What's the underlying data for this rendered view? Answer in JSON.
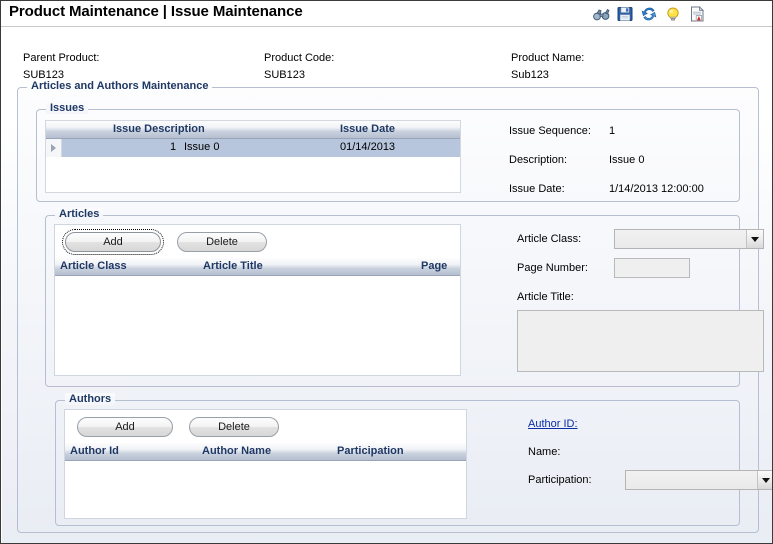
{
  "window": {
    "title_left": "Product Maintenance",
    "title_separator": "|",
    "title_right": "Issue Maintenance"
  },
  "toolbar": {
    "items": [
      {
        "name": "binoculars-icon",
        "label": "Find"
      },
      {
        "name": "save-icon",
        "label": "Save"
      },
      {
        "name": "refresh-icon",
        "label": "Refresh"
      },
      {
        "name": "lightbulb-icon",
        "label": "Hint"
      },
      {
        "name": "report-icon",
        "label": "Report"
      }
    ]
  },
  "header": {
    "parent_product_label": "Parent Product:",
    "parent_product_value": "SUB123",
    "product_code_label": "Product Code:",
    "product_code_value": "SUB123",
    "product_name_label": "Product Name:",
    "product_name_value": "Sub123"
  },
  "main_group": {
    "title": "Articles and Authors Maintenance"
  },
  "issues": {
    "title": "Issues",
    "grid": {
      "columns": [
        "Issue Description",
        "Issue Date"
      ],
      "rows": [
        {
          "sequence": "1",
          "description": "Issue 0",
          "date": "01/14/2013",
          "selected": true
        }
      ]
    },
    "detail": {
      "sequence_label": "Issue Sequence:",
      "sequence_value": "1",
      "description_label": "Description:",
      "description_value": "Issue 0",
      "date_label": "Issue Date:",
      "date_value": "1/14/2013 12:00:00"
    }
  },
  "articles": {
    "title": "Articles",
    "add_button": "Add",
    "delete_button": "Delete",
    "grid": {
      "columns": [
        "Article Class",
        "Article Title",
        "Page"
      ],
      "rows": []
    },
    "detail": {
      "class_label": "Article Class:",
      "class_value": "",
      "page_number_label": "Page Number:",
      "page_number_value": "",
      "title_label": "Article Title:",
      "title_value": ""
    }
  },
  "authors": {
    "title": "Authors",
    "add_button": "Add",
    "delete_button": "Delete",
    "grid": {
      "columns": [
        "Author Id",
        "Author Name",
        "Participation"
      ],
      "rows": []
    },
    "detail": {
      "author_id_label": "Author ID:",
      "author_id_value": "",
      "name_label": "Name:",
      "name_value": "",
      "participation_label": "Participation:",
      "participation_value": ""
    }
  },
  "colors": {
    "title_text": "#000000",
    "group_title": "#1f3864",
    "grid_header_text": "#1f3864",
    "selected_row": "#b8c6dd",
    "link": "#0a2ea8"
  }
}
